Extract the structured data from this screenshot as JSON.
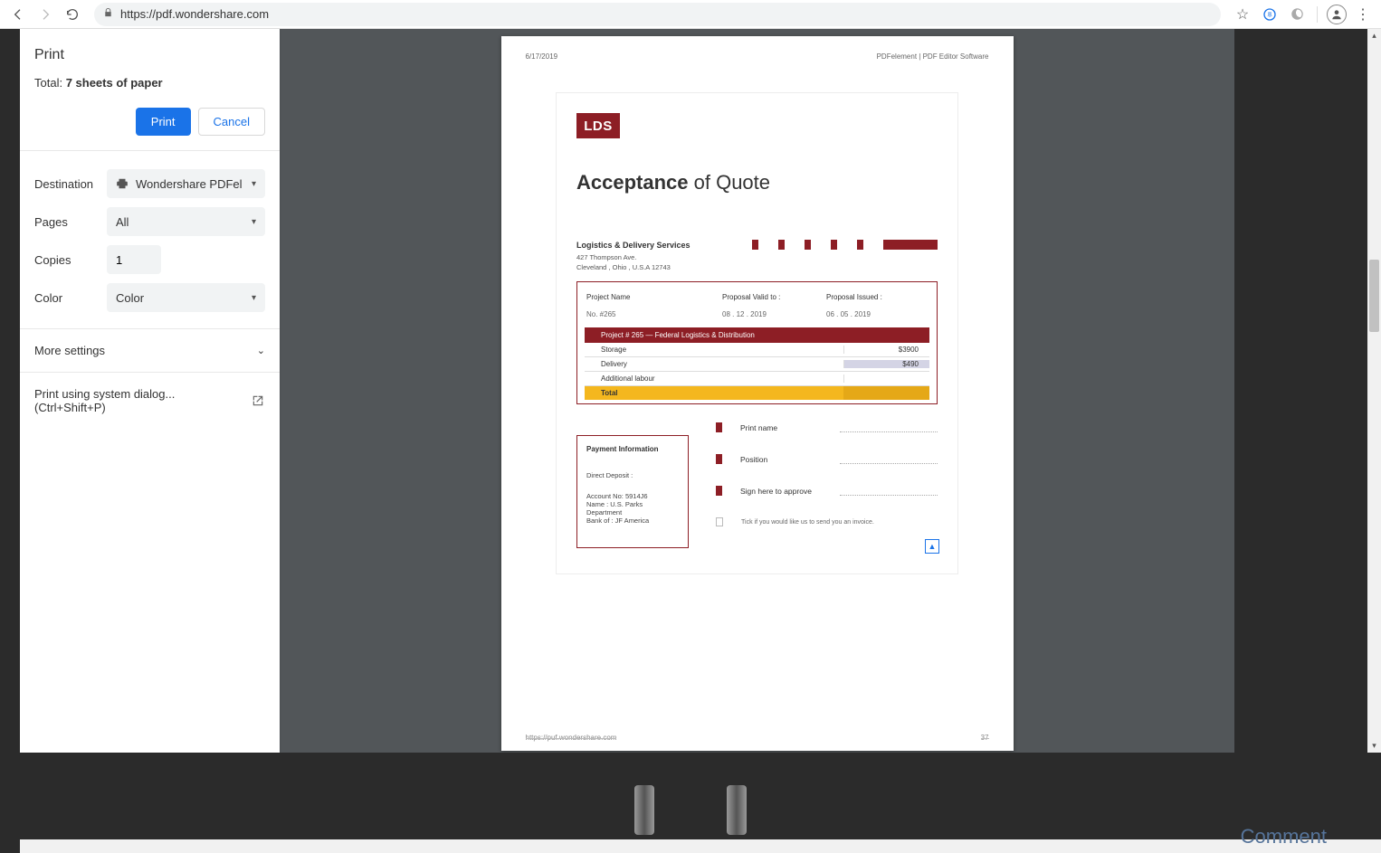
{
  "browser": {
    "url": "https://pdf.wondershare.com"
  },
  "print": {
    "title": "Print",
    "total_prefix": "Total: ",
    "total_value": "7 sheets of paper",
    "print_label": "Print",
    "cancel_label": "Cancel",
    "destination_label": "Destination",
    "destination_value": "Wondershare PDFel",
    "pages_label": "Pages",
    "pages_value": "All",
    "copies_label": "Copies",
    "copies_value": "1",
    "color_label": "Color",
    "color_value": "Color",
    "more_settings": "More settings",
    "system_dialog": "Print using system dialog... (Ctrl+Shift+P)"
  },
  "page": {
    "header_date": "6/17/2019",
    "header_product": "PDFelement | PDF Editor Software",
    "footer_url": "https://puf.wondershare.com",
    "footer_page": "37"
  },
  "doc": {
    "logo": "LDS",
    "title_bold": "Acceptance",
    "title_rest": " of Quote",
    "company": "Logistics & Delivery Services",
    "addr1": "427 Thompson Ave.",
    "addr2": "Cleveland , Ohio , U.S.A 12743",
    "cols": {
      "project": "Project Name",
      "valid": "Proposal Valid to :",
      "issued": "Proposal Issued :"
    },
    "vals": {
      "projno": "No. #265",
      "valid": "08 . 12 . 2019",
      "issued": "06 . 05 . 2019"
    },
    "table": {
      "header": "Project # 265 — Federal Logistics & Distribution",
      "rows": [
        {
          "label": "Storage",
          "amount": "$3900"
        },
        {
          "label": "Delivery",
          "amount": "$490"
        },
        {
          "label": "Additional labour",
          "amount": ""
        }
      ],
      "total_label": "Total"
    },
    "payment": {
      "header": "Payment Information",
      "dd": "Direct Deposit :",
      "l1": "Account No: 5914J6",
      "l2": "Name : U.S. Parks Department",
      "l3": "Bank of : JF America"
    },
    "signs": {
      "print_name": "Print name",
      "position": "Position",
      "sign": "Sign here to approve",
      "invoice_tick": "Tick if you would like us to send you an invoice."
    }
  },
  "watermark": "Comment"
}
